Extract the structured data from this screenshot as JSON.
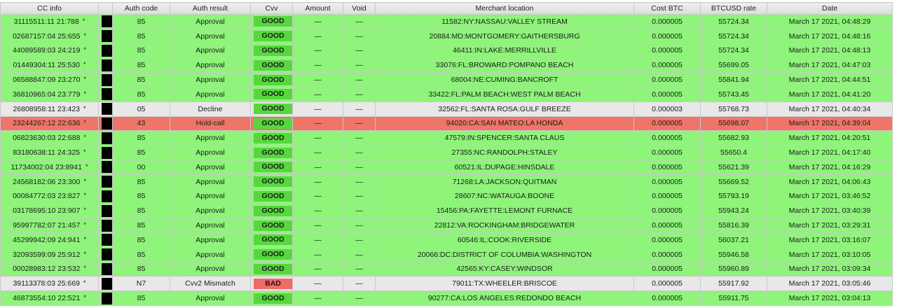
{
  "columns": [
    "CC info",
    "",
    "Auth code",
    "Auth result",
    "Cvv",
    "Amount",
    "Void",
    "Merchant location",
    "Cost BTC",
    "BTCUSD rate",
    "Date"
  ],
  "colors": {
    "approval": "#8ef47a",
    "decline": "#e8e8e8",
    "hold": "#ee7568",
    "good_badge": "#56d83d",
    "bad_badge": "#ee6c62"
  },
  "rows": [
    {
      "cc": "31115511:11 21:788",
      "star": "*",
      "code": "85",
      "result": "Approval",
      "cvv": "GOOD",
      "amount": "—",
      "void": "—",
      "location": "11582:NY:NASSAU:VALLEY STREAM",
      "cost": "0.000005",
      "rate": "55724.34",
      "date": "March 17 2021, 04:48:29",
      "status": "approval"
    },
    {
      "cc": "02687157:04 25:655",
      "star": "*",
      "code": "85",
      "result": "Approval",
      "cvv": "GOOD",
      "amount": "—",
      "void": "—",
      "location": "20884:MD:MONTGOMERY:GAITHERSBURG",
      "cost": "0.000005",
      "rate": "55724.34",
      "date": "March 17 2021, 04:48:16",
      "status": "approval"
    },
    {
      "cc": "44089589:03 24:219",
      "star": "*",
      "code": "85",
      "result": "Approval",
      "cvv": "GOOD",
      "amount": "—",
      "void": "—",
      "location": "46411:IN:LAKE:MERRILLVILLE",
      "cost": "0.000005",
      "rate": "55724.34",
      "date": "March 17 2021, 04:48:13",
      "status": "approval"
    },
    {
      "cc": "01449304:11 25:530",
      "star": "*",
      "code": "85",
      "result": "Approval",
      "cvv": "GOOD",
      "amount": "—",
      "void": "—",
      "location": "33076:FL:BROWARD:POMPANO BEACH",
      "cost": "0.000005",
      "rate": "55699.05",
      "date": "March 17 2021, 04:47:03",
      "status": "approval"
    },
    {
      "cc": "06588847:09 23:270",
      "star": "*",
      "code": "85",
      "result": "Approval",
      "cvv": "GOOD",
      "amount": "—",
      "void": "—",
      "location": "68004:NE:CUMING:BANCROFT",
      "cost": "0.000005",
      "rate": "55841.94",
      "date": "March 17 2021, 04:44:51",
      "status": "approval"
    },
    {
      "cc": "36810965:04 23:779",
      "star": "*",
      "code": "85",
      "result": "Approval",
      "cvv": "GOOD",
      "amount": "—",
      "void": "—",
      "location": "33422:FL:PALM BEACH:WEST PALM BEACH",
      "cost": "0.000005",
      "rate": "55743.45",
      "date": "March 17 2021, 04:41:20",
      "status": "approval"
    },
    {
      "cc": "26808958:11 23:423",
      "star": "*",
      "code": "05",
      "result": "Decline",
      "cvv": "GOOD",
      "amount": "—",
      "void": "—",
      "location": "32562:FL:SANTA ROSA:GULF BREEZE",
      "cost": "0.000003",
      "rate": "55768.73",
      "date": "March 17 2021, 04:40:34",
      "status": "decline"
    },
    {
      "cc": "23244267:12 22:636",
      "star": "*",
      "code": "43",
      "result": "Hold-call",
      "cvv": "GOOD",
      "amount": "—",
      "void": "—",
      "location": "94020:CA:SAN MATEO:LA HONDA",
      "cost": "0.000005",
      "rate": "55698.07",
      "date": "March 17 2021, 04:39:04",
      "status": "hold"
    },
    {
      "cc": "06823630:03 22:688",
      "star": "*",
      "code": "85",
      "result": "Approval",
      "cvv": "GOOD",
      "amount": "—",
      "void": "—",
      "location": "47579:IN:SPENCER:SANTA CLAUS",
      "cost": "0.000005",
      "rate": "55682.93",
      "date": "March 17 2021, 04:20:51",
      "status": "approval"
    },
    {
      "cc": "83180638:11 24:325",
      "star": "*",
      "code": "85",
      "result": "Approval",
      "cvv": "GOOD",
      "amount": "—",
      "void": "—",
      "location": "27355:NC:RANDOLPH:STALEY",
      "cost": "0.000005",
      "rate": "55650.4",
      "date": "March 17 2021, 04:17:40",
      "status": "approval"
    },
    {
      "cc": "11734002:04 23:8941",
      "star": "*",
      "code": "00",
      "result": "Approval",
      "cvv": "GOOD",
      "amount": "—",
      "void": "—",
      "location": "60521:IL:DUPAGE:HINSDALE",
      "cost": "0.000005",
      "rate": "55621.39",
      "date": "March 17 2021, 04:16:29",
      "status": "approval"
    },
    {
      "cc": "24568182:06 23:300",
      "star": "*",
      "code": "85",
      "result": "Approval",
      "cvv": "GOOD",
      "amount": "—",
      "void": "—",
      "location": "71268:LA:JACKSON:QUITMAN",
      "cost": "0.000005",
      "rate": "55669.52",
      "date": "March 17 2021, 04:06:43",
      "status": "approval"
    },
    {
      "cc": "00084772:03 23:827",
      "star": "*",
      "code": "85",
      "result": "Approval",
      "cvv": "GOOD",
      "amount": "—",
      "void": "—",
      "location": "28607:NC:WATAUGA:BOONE",
      "cost": "0.000005",
      "rate": "55793.19",
      "date": "March 17 2021, 03:46:52",
      "status": "approval"
    },
    {
      "cc": "03178695:10 23:907",
      "star": "*",
      "code": "85",
      "result": "Approval",
      "cvv": "GOOD",
      "amount": "—",
      "void": "—",
      "location": "15456:PA:FAYETTE:LEMONT FURNACE",
      "cost": "0.000005",
      "rate": "55943.24",
      "date": "March 17 2021, 03:40:39",
      "status": "approval"
    },
    {
      "cc": "95997782:07 21:457",
      "star": "*",
      "code": "85",
      "result": "Approval",
      "cvv": "GOOD",
      "amount": "—",
      "void": "—",
      "location": "22812:VA:ROCKINGHAM:BRIDGEWATER",
      "cost": "0.000005",
      "rate": "55816.39",
      "date": "March 17 2021, 03:29:31",
      "status": "approval"
    },
    {
      "cc": "45299942:09 24:941",
      "star": "*",
      "code": "85",
      "result": "Approval",
      "cvv": "GOOD",
      "amount": "—",
      "void": "—",
      "location": "60546:IL:COOK:RIVERSIDE",
      "cost": "0.000005",
      "rate": "56037.21",
      "date": "March 17 2021, 03:16:07",
      "status": "approval"
    },
    {
      "cc": "32093599:09 25:912",
      "star": "*",
      "code": "85",
      "result": "Approval",
      "cvv": "GOOD",
      "amount": "—",
      "void": "—",
      "location": "20066:DC:DISTRICT OF COLUMBIA:WASHINGTON",
      "cost": "0.000005",
      "rate": "55946.58",
      "date": "March 17 2021, 03:10:05",
      "status": "approval"
    },
    {
      "cc": "00028983:12 23:532",
      "star": "*",
      "code": "85",
      "result": "Approval",
      "cvv": "GOOD",
      "amount": "—",
      "void": "—",
      "location": "42565:KY:CASEY:WINDSOR",
      "cost": "0.000005",
      "rate": "55960.89",
      "date": "March 17 2021, 03:09:34",
      "status": "approval"
    },
    {
      "cc": "39113378:03 25:669",
      "star": "*",
      "code": "N7",
      "result": "Cvv2 Mismatch",
      "cvv": "BAD",
      "amount": "—",
      "void": "—",
      "location": "79011:TX:WHEELER:BRISCOE",
      "cost": "0.000005",
      "rate": "55917.92",
      "date": "March 17 2021, 03:05:46",
      "status": "decline"
    },
    {
      "cc": "46873554:10 22:521",
      "star": "*",
      "code": "85",
      "result": "Approval",
      "cvv": "GOOD",
      "amount": "—",
      "void": "—",
      "location": "90277:CA:LOS ANGELES:REDONDO BEACH",
      "cost": "0.000005",
      "rate": "55911.75",
      "date": "March 17 2021, 03:04:13",
      "status": "approval"
    }
  ]
}
